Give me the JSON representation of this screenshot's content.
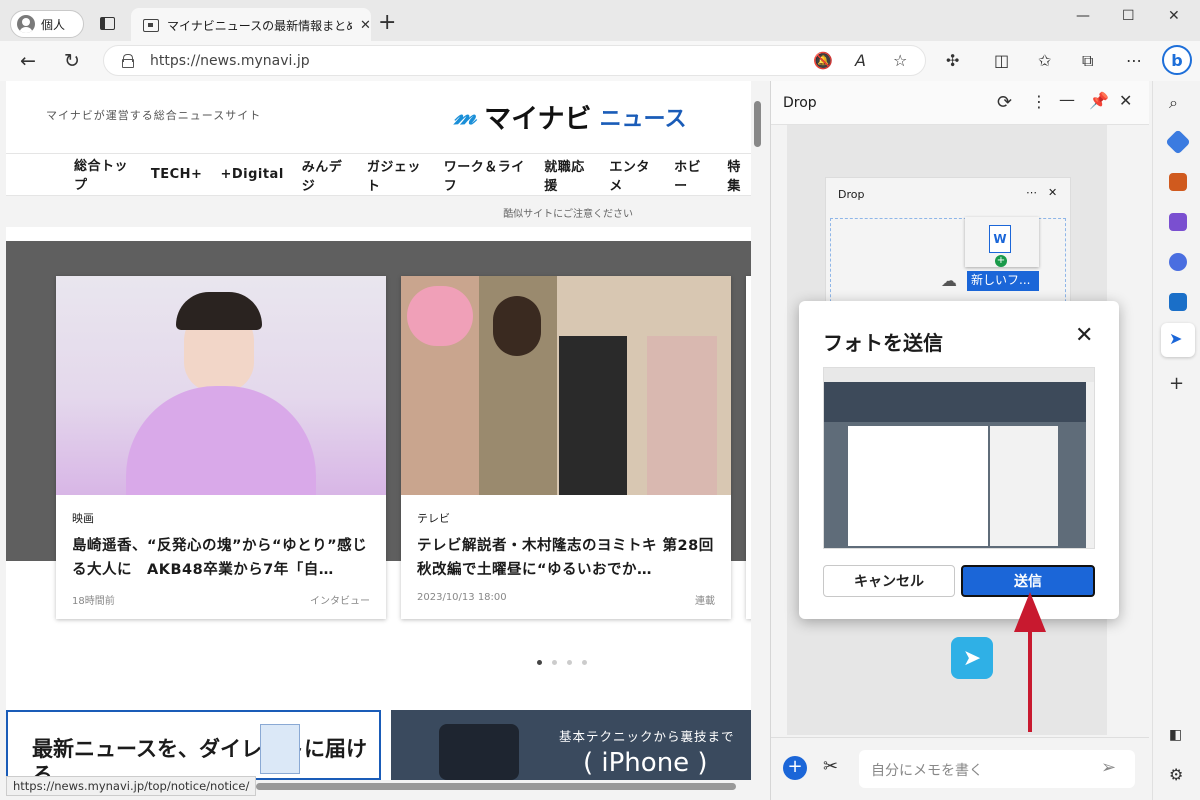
{
  "browser": {
    "profile_label": "個人",
    "tab_title": "マイナビニュースの最新情報まとめ - エ",
    "url": "https://news.mynavi.jp",
    "new_tab": "+",
    "tab_close": "✕",
    "window_controls": [
      "—",
      "☐",
      "✕"
    ]
  },
  "page": {
    "tagline": "マイナビが運営する総合ニュースサイト",
    "logo_name": "マイナビ",
    "logo_news": "ニュース",
    "nav": [
      "総合トップ",
      "TECH+",
      "+Digital",
      "みんデジ",
      "ガジェット",
      "ワーク＆ライフ",
      "就職応援",
      "エンタメ",
      "ホビー",
      "特集"
    ],
    "notice": "酷似サイトにご注意ください",
    "cards": [
      {
        "category": "映画",
        "title": "島崎遥香、“反発心の塊”から“ゆとり”感じる大人に　AKB48卒業から7年「自…",
        "time": "18時間前",
        "label": "インタビュー"
      },
      {
        "category": "テレビ",
        "title": "テレビ解説者・木村隆志のヨミトキ 第28回 秋改編で土曜昼に“ゆるいおでか…",
        "time": "2023/10/13 18:00",
        "label": "連載"
      }
    ],
    "promo1": "最新ニュースを、ダイレクトに届ける",
    "promo2_small": "基本テクニックから裏技まで",
    "promo2_big": "( iPhone )",
    "status_url": "https://news.mynavi.jp/top/notice/notice/"
  },
  "drop": {
    "title": "Drop",
    "mini_title": "Drop",
    "mini_file": "新しいフ...",
    "dialog_title": "フォトを送信",
    "cancel": "キャンセル",
    "send": "送信",
    "input_placeholder": "自分にメモを書く"
  },
  "colors": {
    "accent": "#1b66d8",
    "arrow": "#c8192f",
    "logo_blue": "#1a5cb8"
  }
}
